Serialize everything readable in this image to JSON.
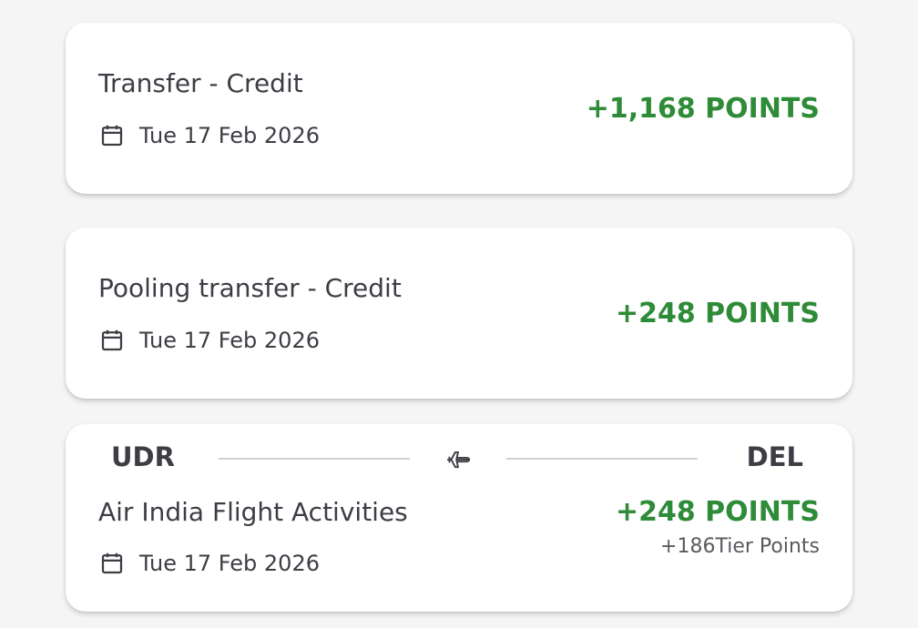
{
  "colors": {
    "points_green": "#2e8b38",
    "text_dark": "#3d3d45",
    "divider": "#d0d0d0"
  },
  "transactions": [
    {
      "title": "Transfer - Credit",
      "date": "Tue 17 Feb 2026",
      "points": "+1,168 POINTS",
      "date_icon": "calendar-icon"
    },
    {
      "title": "Pooling transfer - Credit",
      "date": "Tue 17 Feb 2026",
      "points": "+248 POINTS",
      "date_icon": "calendar-icon"
    },
    {
      "origin": "UDR",
      "destination": "DEL",
      "route_icon": "airplane-icon",
      "title": "Air India Flight Activities",
      "date": "Tue 17 Feb 2026",
      "points": "+248 POINTS",
      "tier_points": "+186Tier Points",
      "date_icon": "calendar-icon"
    }
  ]
}
